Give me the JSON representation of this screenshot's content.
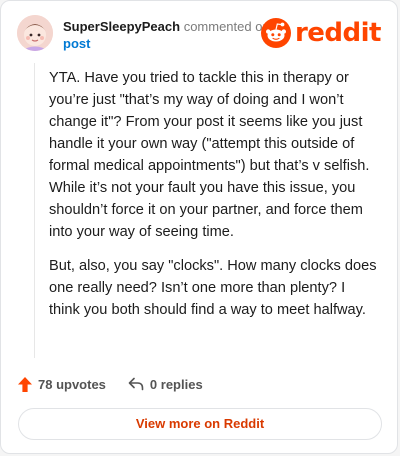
{
  "header": {
    "username": "SuperSleepyPeach",
    "action": "commented on",
    "post_link": "post",
    "logo_text": "reddit",
    "logo_icon": "reddit-snoo-icon",
    "avatar_icon": "avatar"
  },
  "comment": {
    "paragraphs": [
      "YTA. Have you tried to tackle this in therapy or you’re just \"that’s my way of doing and I won’t change it\"? From your post it seems like you just handle it your own way (\"attempt this outside of formal medical appointments\") but that’s v selfish. While it’s not your fault you have this issue, you shouldn’t force it on your partner, and force them into your way of seeing time.",
      "But, also, you say \"clocks\". How many clocks does one really need? Isn’t one more than plenty? I think you both should find a way to meet halfway."
    ]
  },
  "footer": {
    "upvotes": "78 upvotes",
    "replies": "0 replies",
    "upvote_icon": "upvote-arrow-icon",
    "reply_icon": "reply-arrow-icon"
  },
  "view_more": "View more on Reddit",
  "colors": {
    "brand": "#ff4500",
    "link": "#0079d3",
    "button_text": "#d93a00"
  }
}
